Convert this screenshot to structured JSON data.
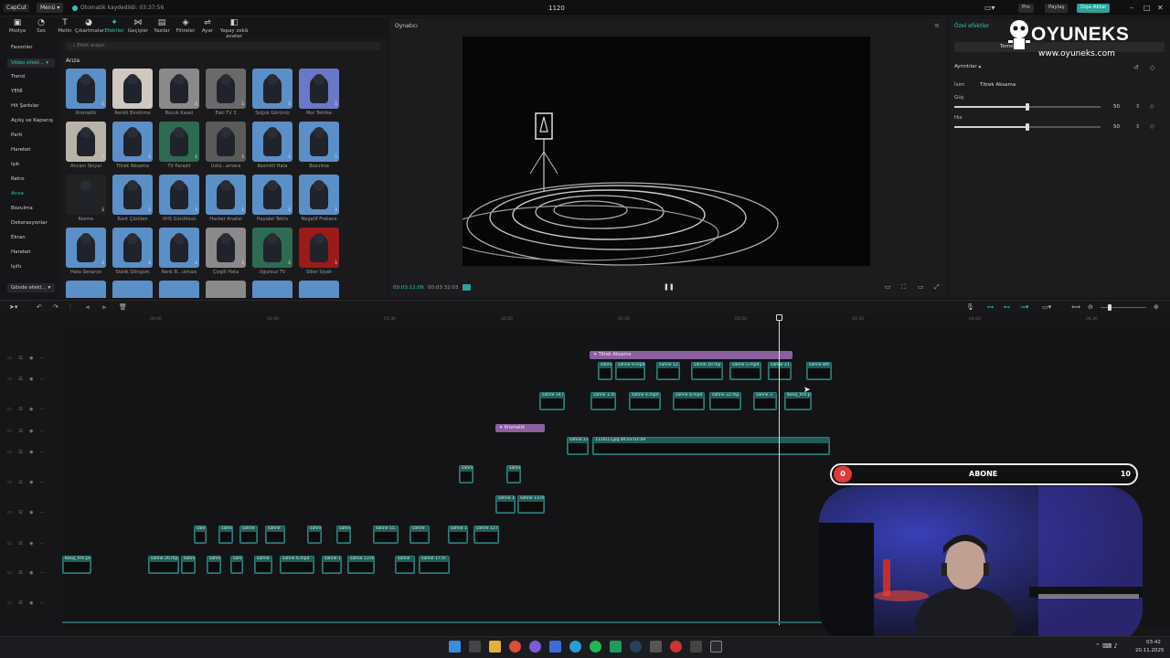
{
  "app": {
    "logo": "CapCut",
    "menu": "Menü",
    "save_status": "Otomatik kaydedildi: 03:37:56",
    "project_title": "1120",
    "pro": "Pro",
    "share": "Paylaş",
    "export": "Dışa Aktar"
  },
  "toolbar": [
    {
      "label": "Medya",
      "icon": "media-icon"
    },
    {
      "label": "Ses",
      "icon": "audio-icon"
    },
    {
      "label": "Metin",
      "icon": "text-icon"
    },
    {
      "label": "Çıkartmalar",
      "icon": "sticker-icon"
    },
    {
      "label": "Efektler",
      "icon": "effects-icon",
      "active": true
    },
    {
      "label": "Geçişler",
      "icon": "transitions-icon"
    },
    {
      "label": "Yazılar",
      "icon": "captions-icon"
    },
    {
      "label": "Filtreler",
      "icon": "filters-icon"
    },
    {
      "label": "Ayar",
      "icon": "adjust-icon"
    },
    {
      "label": "Yapay zekâ avatar",
      "icon": "avatar-icon"
    }
  ],
  "nav": {
    "favorites": "Favoriler",
    "video_effects": "Video efekt...",
    "items": [
      "Trend",
      "YENİ",
      "Hit Şarkılar",
      "Açılış ve Kapanış",
      "Parti",
      "Hareket",
      "Işık",
      "Retro",
      "Arıza",
      "Bozulma",
      "Dekorasyonlar",
      "Ekran",
      "Hareket",
      "Işıltı"
    ],
    "active_index": 8,
    "body_effects": "Gövde efekt..."
  },
  "effects": {
    "search_placeholder": "Efekt arayın",
    "heading": "Arıza",
    "tiles": [
      {
        "label": "Kromatik",
        "color": "#5b8fc7"
      },
      {
        "label": "Renkli Bindirme",
        "color": "#cfc8c0"
      },
      {
        "label": "Bozuk Kaset",
        "color": "#8a8a8a"
      },
      {
        "label": "Eski TV 3",
        "color": "#6a6a6a"
      },
      {
        "label": "Soğuk Görüntü",
        "color": "#5b8fc7"
      },
      {
        "label": "Mor Tehlike",
        "color": "#6b78c8"
      },
      {
        "label": "Ancaın Sinyal",
        "color": "#b9b2a6"
      },
      {
        "label": "Titrek Aksama",
        "color": "#5b8fc7"
      },
      {
        "label": "TV Parazit",
        "color": "#2f6b52"
      },
      {
        "label": "Üstü...amera",
        "color": "#5a5a5a"
      },
      {
        "label": "Kesintili Hata",
        "color": "#5b8fc7"
      },
      {
        "label": "Bozulma",
        "color": "#5b8fc7"
      },
      {
        "label": "Kesme",
        "color": "#222222"
      },
      {
        "label": "Bant Çözülen",
        "color": "#5b8fc7"
      },
      {
        "label": "VHS Gürültüsü",
        "color": "#5b8fc7"
      },
      {
        "label": "Hacker Analizi",
        "color": "#5b8fc7"
      },
      {
        "label": "Hayalet Tetris",
        "color": "#5b8fc7"
      },
      {
        "label": "Negatif Frekans",
        "color": "#5b8fc7"
      },
      {
        "label": "Hata Senaryo",
        "color": "#5b8fc7"
      },
      {
        "label": "Statik Döngüm",
        "color": "#5b8fc7"
      },
      {
        "label": "Renk B...ulması",
        "color": "#5b8fc7"
      },
      {
        "label": "Çizgili Hata",
        "color": "#8a8a8a"
      },
      {
        "label": "Uğursuz TV",
        "color": "#2f6b52"
      },
      {
        "label": "Siber Siyah",
        "color": "#9b1a1a"
      }
    ]
  },
  "player": {
    "title": "Oynatıcı",
    "current_time": "00:03:11:09",
    "total_time": "00:03:32:03"
  },
  "right_panel": {
    "title": "Özel efektler",
    "tab": "Temel",
    "details": "Ayrıntılar",
    "name_label": "İsim",
    "name_value": "Titrek Aksama",
    "params": [
      {
        "label": "Güç",
        "value": "50",
        "fraction": 0.5
      },
      {
        "label": "Hız",
        "value": "50",
        "fraction": 0.5
      }
    ]
  },
  "watermark": {
    "name": "OYUNEKS",
    "url": "www.oyuneks.com"
  },
  "timeline": {
    "ruler": [
      "00:00",
      "01:00",
      "01:30",
      "02:00",
      "02:30",
      "03:00",
      "03:30",
      "04:00",
      "04:30"
    ],
    "fx_clips": [
      {
        "label": "Titrek Aksama",
        "row": 0
      },
      {
        "label": "Kromatik",
        "row": 3
      }
    ],
    "clips": [
      {
        "label": "sahne",
        "row": 1
      },
      {
        "label": "sahne 9.mp4",
        "row": 1
      },
      {
        "label": "sahne 12.",
        "row": 1
      },
      {
        "label": "sahne 10.mp",
        "row": 1
      },
      {
        "label": "sahne 5.mp4",
        "row": 1
      },
      {
        "label": "sahne 21.",
        "row": 1
      },
      {
        "label": "sahne 8m",
        "row": 1
      },
      {
        "label": "sahne 14.m",
        "row": 2
      },
      {
        "label": "sahne 1.m",
        "row": 2
      },
      {
        "label": "sahne 4.mp4",
        "row": 2
      },
      {
        "label": "sahne 8.mp4",
        "row": 2
      },
      {
        "label": "sahne 22.mp",
        "row": 2
      },
      {
        "label": "sahne 3",
        "row": 2
      },
      {
        "label": "Kesiş_frm.png",
        "row": 2
      },
      {
        "label": "sahne 23",
        "row": 4
      },
      {
        "label": "1120(1).jpg  00:03:01:09",
        "row": 4
      },
      {
        "label": "sahne",
        "row": 5
      },
      {
        "label": "sahne",
        "row": 5
      },
      {
        "label": "sahne 1",
        "row": 6
      },
      {
        "label": "sahne 13.m",
        "row": 6
      },
      {
        "label": "sahne",
        "row": 7
      },
      {
        "label": "sahne",
        "row": 7
      },
      {
        "label": "sahne",
        "row": 7
      },
      {
        "label": "sahne",
        "row": 7
      },
      {
        "label": "sahne",
        "row": 7
      },
      {
        "label": "sahne",
        "row": 7
      },
      {
        "label": "sahne 15.",
        "row": 7
      },
      {
        "label": "sahne",
        "row": 7
      },
      {
        "label": "sahne 1",
        "row": 7
      },
      {
        "label": "sahne 12.m",
        "row": 7
      },
      {
        "label": "Kesiş_frm.png",
        "row": 8
      },
      {
        "label": "sahne 20.mp",
        "row": 8
      },
      {
        "label": "sahne",
        "row": 8
      },
      {
        "label": "sahne",
        "row": 8
      },
      {
        "label": "sahne",
        "row": 8
      },
      {
        "label": "sahne",
        "row": 8
      },
      {
        "label": "sahne 6.mp4",
        "row": 8
      },
      {
        "label": "sahne 1",
        "row": 8
      },
      {
        "label": "sahne 13.m",
        "row": 8
      },
      {
        "label": "sahne",
        "row": 8
      },
      {
        "label": "sahne 17.m",
        "row": 8
      }
    ]
  },
  "overlay": {
    "count": "0",
    "label": "ABONE",
    "goal": "10"
  },
  "taskbar": {
    "time": "03:42",
    "date": "20.11.2025"
  }
}
